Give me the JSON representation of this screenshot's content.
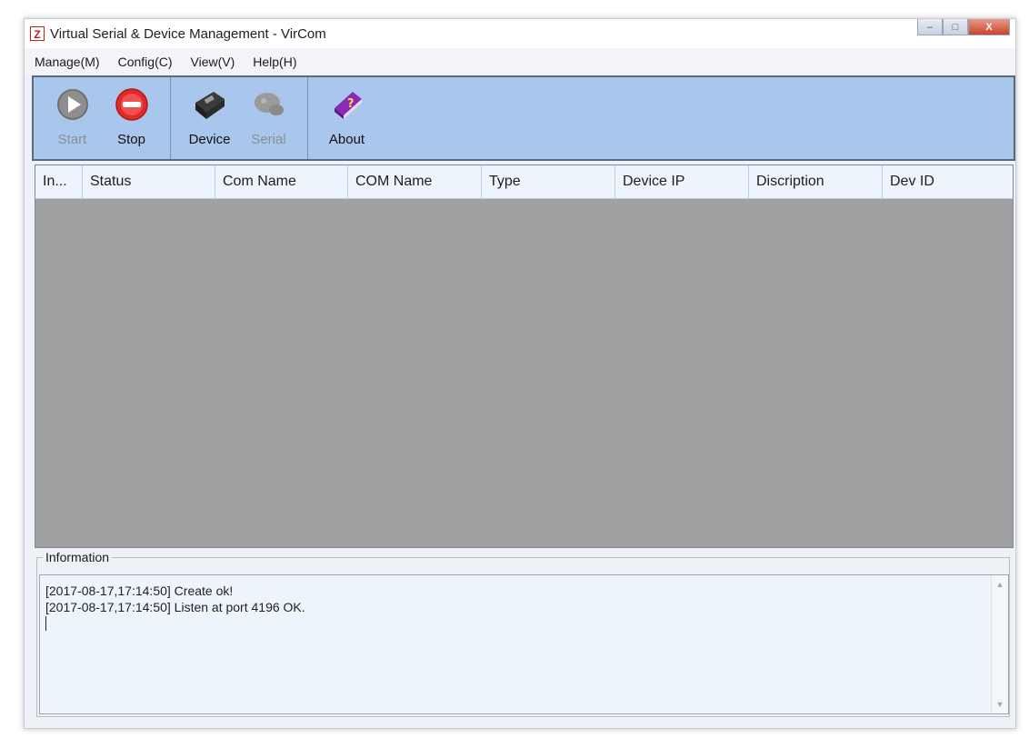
{
  "window": {
    "title": "Virtual Serial & Device Management - VirCom",
    "logo_letter": "Z",
    "controls": {
      "minimize": "–",
      "maximize": "□",
      "close": "X"
    }
  },
  "menu": [
    "Manage(M)",
    "Config(C)",
    "View(V)",
    "Help(H)"
  ],
  "toolbar": {
    "start": {
      "label": "Start",
      "icon": "play-icon",
      "enabled": false
    },
    "stop": {
      "label": "Stop",
      "icon": "stop-icon",
      "enabled": true
    },
    "device": {
      "label": "Device",
      "icon": "device-icon",
      "enabled": true
    },
    "serial": {
      "label": "Serial",
      "icon": "serial-icon",
      "enabled": false
    },
    "about": {
      "label": "About",
      "icon": "about-book-icon",
      "enabled": true
    }
  },
  "table": {
    "columns": [
      "In...",
      "Status",
      "Com Name",
      "COM Name",
      "Type",
      "Device IP",
      "Discription",
      "Dev ID"
    ],
    "rows": []
  },
  "information": {
    "legend": "Information",
    "lines": [
      "[2017-08-17,17:14:50] Create ok!",
      "[2017-08-17,17:14:50] Listen at port 4196 OK."
    ]
  },
  "colors": {
    "toolbar_bg": "#a9c6ec",
    "grid_bg": "#a0a0a0",
    "stop_red": "#e02a2a",
    "about_purple": "#8a2bb5"
  }
}
